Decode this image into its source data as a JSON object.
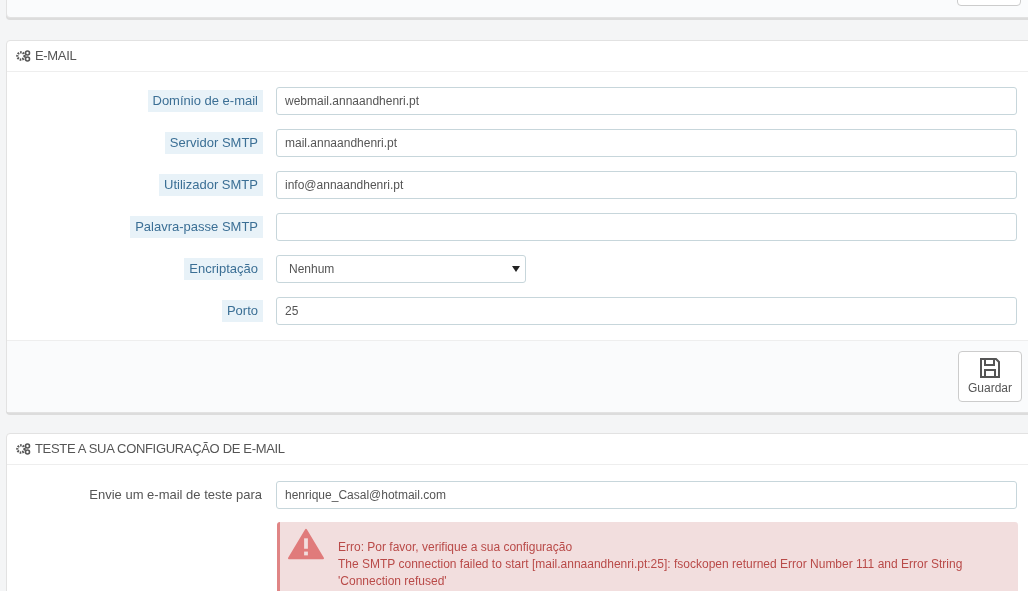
{
  "email_panel": {
    "title": "E-MAIL",
    "fields": [
      {
        "label": "Domínio de e-mail",
        "kind": "text",
        "value": "webmail.annaandhenri.pt"
      },
      {
        "label": "Servidor SMTP",
        "kind": "text",
        "value": "mail.annaandhenri.pt"
      },
      {
        "label": "Utilizador SMTP",
        "kind": "text",
        "value": "info@annaandhenri.pt"
      },
      {
        "label": "Palavra-passe SMTP",
        "kind": "password"
      },
      {
        "label": "Encriptação",
        "kind": "select",
        "value": "Nenhum"
      },
      {
        "label": "Porto",
        "kind": "text",
        "value": "25"
      }
    ],
    "save_button": "Guardar"
  },
  "test_panel": {
    "title": "TESTE A SUA CONFIGURAÇÃO DE E-MAIL",
    "label": "Envie um e-mail de teste para",
    "value": "henrique_Casal@hotmail.com",
    "error": {
      "title": "Erro: Por favor, verifique a sua configuração",
      "message": "The SMTP connection failed to start [mail.annaandhenri.pt:25]: fsockopen returned Error Number 111 and Error String 'Connection refused'"
    }
  }
}
